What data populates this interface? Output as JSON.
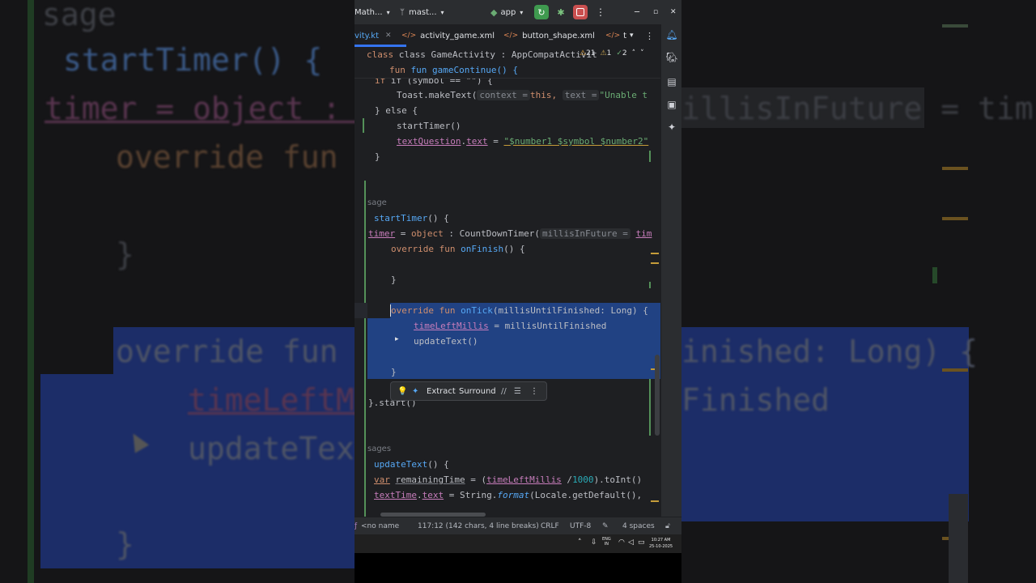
{
  "background": {
    "left_lines": [
      {
        "text": "sage"
      },
      {
        "text": "startTimer() {"
      },
      {
        "text": "timer = object : C"
      },
      {
        "text": "override fun o"
      },
      {
        "text": "}"
      },
      {
        "text": "override fun o"
      },
      {
        "text": "timeLeftMil"
      },
      {
        "text": "updateText"
      },
      {
        "text": "}"
      }
    ],
    "right_lines": [
      {
        "text": "illisInFuture = tim"
      },
      {
        "text": "inished: Long) {"
      },
      {
        "text": "Finished"
      }
    ]
  },
  "titlebar": {
    "project": "Math...",
    "branch": "mast...",
    "run_config": "app",
    "icons": [
      "chevron-down-icon",
      "branch-icon",
      "android-icon",
      "rerun-icon",
      "debug-icon",
      "stop-icon",
      "more-icon",
      "minimize-icon",
      "maximize-icon",
      "close-icon"
    ]
  },
  "window_controls": {
    "minimize": "─",
    "maximize": "▫",
    "close": "✕"
  },
  "tabs": {
    "items": [
      {
        "label": "vity.kt",
        "active": true
      },
      {
        "label": "activity_game.xml",
        "active": false
      },
      {
        "label": "button_shape.xml",
        "active": false
      },
      {
        "label": "t",
        "active": false
      }
    ],
    "close": "✕",
    "more": "⋮"
  },
  "editor": {
    "sticky_class": "class GameActivity : AppCompatActivit",
    "sticky_fun": "fun gameContinue() {",
    "warnings": "21",
    "weak_warnings": "1",
    "typos": "2",
    "lines": {
      "l1": "if (symbol == \"\") {",
      "l2_a": "Toast.makeText(",
      "l2_hint1": "context =",
      "l2_b": "this,",
      "l2_hint2": "text =",
      "l2_c": "\"Unable t",
      "l3": "} else {",
      "l4": "startTimer()",
      "l5_a": "textQuestion",
      "l5_b": ".",
      "l5_c": "text",
      "l5_d": " = ",
      "l5_e": "\"$number1 $symbol $number2\"",
      "l6": "}",
      "usages1": "sage",
      "l8_a": "startTimer",
      "l8_b": "() {",
      "l9_a": "timer",
      "l9_b": " = ",
      "l9_c": "object",
      "l9_d": " : CountDownTimer(",
      "l9_hint": "millisInFuture =",
      "l9_e": "tim",
      "l10_a": "override fun ",
      "l10_b": "onFinish",
      "l10_c": "() {",
      "l11": "}",
      "l12_a": "override fun ",
      "l12_b": "onTick",
      "l12_c": "(millisUntilFinished: Long) {",
      "l13_a": "timeLeftMillis",
      "l13_b": " = millisUntilFinished",
      "l14": "updateText()",
      "l15": "}",
      "l16": "}.start()",
      "usages2": "sages",
      "l18_a": "updateText",
      "l18_b": "() {",
      "l19_a": "var",
      "l19_b": "remainingTime",
      "l19_c": " = (",
      "l19_d": "timeLeftMillis",
      "l19_e": " /",
      "l19_f": "1000",
      "l19_g": ").toInt()",
      "l20_a": "textTime",
      "l20_b": ".",
      "l20_c": "text",
      "l20_d": " = String.",
      "l20_e": "format",
      "l20_f": "(Locale.getDefault(),"
    }
  },
  "popup": {
    "extract": "Extract",
    "surround": "Surround",
    "comment": "//"
  },
  "statusbar": {
    "left": "<no name",
    "position": "117:12 (142 chars, 4 line breaks)",
    "line_sep": "CRLF",
    "encoding": "UTF-8",
    "indent": "4 spaces"
  },
  "taskbar": {
    "lang1": "ENG",
    "lang2": "IN",
    "time": "10:27 AM",
    "date": "25-10-2025"
  }
}
